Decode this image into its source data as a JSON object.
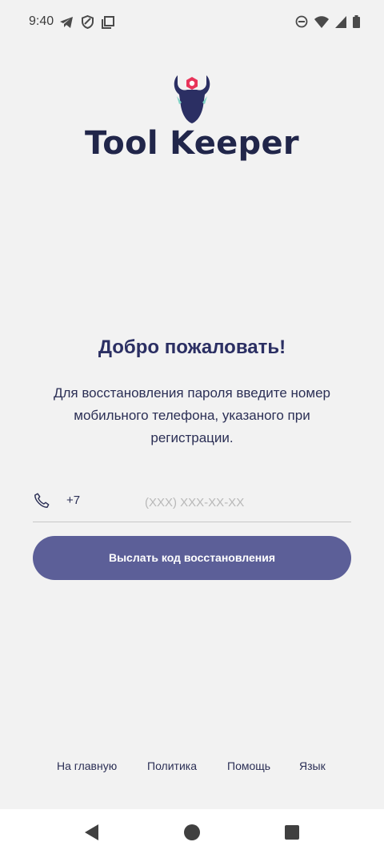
{
  "status_bar": {
    "time": "9:40",
    "icons": [
      "telegram-icon",
      "shield-icon",
      "copy-icon",
      "dnd-icon",
      "wifi-icon",
      "signal-icon",
      "battery-icon"
    ]
  },
  "brand": {
    "name": "Tool Keeper",
    "colors": {
      "dark": "#21264a",
      "accent": "#e8345a",
      "teal": "#7fd3c6"
    }
  },
  "welcome": {
    "title": "Добро пожаловать!",
    "description": "Для восстановления пароля введите номер мобильного телефона, указаного при регистрации."
  },
  "phone": {
    "prefix": "+7",
    "value": "",
    "placeholder": "(XXX) XXX-XX-XX"
  },
  "actions": {
    "send_code_label": "Выслать код восстановления",
    "button_color": "#5c5f98"
  },
  "footer": {
    "home": "На главную",
    "policy": "Политика",
    "help": "Помощь",
    "language": "Язык"
  },
  "nav": {
    "icons": [
      "back-icon",
      "home-icon",
      "recents-icon"
    ]
  }
}
